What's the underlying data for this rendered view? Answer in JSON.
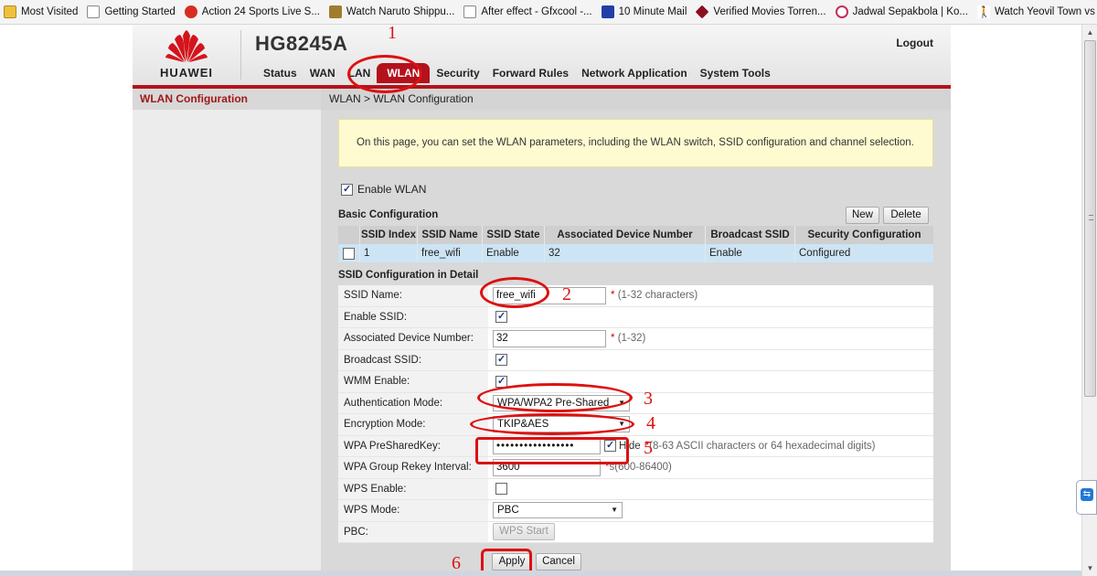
{
  "bookmarks": [
    {
      "label": "Most Visited",
      "icon": "folder-icon"
    },
    {
      "label": "Getting Started",
      "icon": "page-icon"
    },
    {
      "label": "Action 24 Sports Live S...",
      "icon": "record-icon"
    },
    {
      "label": "Watch Naruto Shippu...",
      "icon": "image-icon"
    },
    {
      "label": "After effect - Gfxcool -...",
      "icon": "page-icon"
    },
    {
      "label": "10 Minute Mail",
      "icon": "mail-icon"
    },
    {
      "label": "Verified Movies Torren...",
      "icon": "cube-icon"
    },
    {
      "label": "Jadwal Sepakbola | Ko...",
      "icon": "circle-icon"
    },
    {
      "label": "Watch Yeovil Town vs ...",
      "icon": "walker-icon"
    }
  ],
  "header": {
    "brand": "HUAWEI",
    "model": "HG8245A",
    "logout": "Logout",
    "brand_color": "#b3121c"
  },
  "nav": {
    "items": [
      "Status",
      "WAN",
      "LAN",
      "WLAN",
      "Security",
      "Forward Rules",
      "Network Application",
      "System Tools"
    ],
    "active": "WLAN"
  },
  "sidebar": {
    "title": "WLAN Configuration"
  },
  "breadcrumb": "WLAN > WLAN Configuration",
  "notice": "On this page, you can set the WLAN parameters, including the WLAN switch, SSID configuration and channel selection.",
  "enable_wlan": {
    "label": "Enable WLAN",
    "checked": true
  },
  "basic": {
    "title": "Basic Configuration",
    "new_label": "New",
    "delete_label": "Delete",
    "columns": [
      "",
      "SSID Index",
      "SSID Name",
      "SSID State",
      "Associated Device Number",
      "Broadcast SSID",
      "Security Configuration"
    ],
    "rows": [
      [
        "",
        "1",
        "free_wifi",
        "Enable",
        "32",
        "Enable",
        "Configured"
      ]
    ]
  },
  "detail": {
    "title": "SSID Configuration in Detail",
    "ssid_name": {
      "label": "SSID Name:",
      "value": "free_wifi",
      "note": "(1-32 characters)"
    },
    "enable_ssid": {
      "label": "Enable SSID:",
      "checked": true
    },
    "assoc_num": {
      "label": "Associated Device Number:",
      "value": "32",
      "note": "(1-32)"
    },
    "broadcast_ssid": {
      "label": "Broadcast SSID:",
      "checked": true
    },
    "wmm": {
      "label": "WMM Enable:",
      "checked": true
    },
    "auth_mode": {
      "label": "Authentication Mode:",
      "value": "WPA/WPA2 Pre-Shared"
    },
    "enc_mode": {
      "label": "Encryption Mode:",
      "value": "TKIP&AES"
    },
    "psk": {
      "label": "WPA PreSharedKey:",
      "value": "•••••••••••••••••",
      "hide_label": "Hide",
      "note": "(8-63 ASCII characters or 64 hexadecimal digits)",
      "hide_checked": true
    },
    "rekey": {
      "label": "WPA Group Rekey Interval:",
      "value": "3600",
      "note": "s(600-86400)"
    },
    "wps_enable": {
      "label": "WPS Enable:",
      "checked": false
    },
    "wps_mode": {
      "label": "WPS Mode:",
      "value": "PBC"
    },
    "pbc": {
      "label": "PBC:",
      "button": "WPS Start"
    }
  },
  "actions": {
    "apply": "Apply",
    "cancel": "Cancel"
  },
  "annotations": [
    "1",
    "2",
    "3",
    "4",
    "5",
    "6"
  ]
}
